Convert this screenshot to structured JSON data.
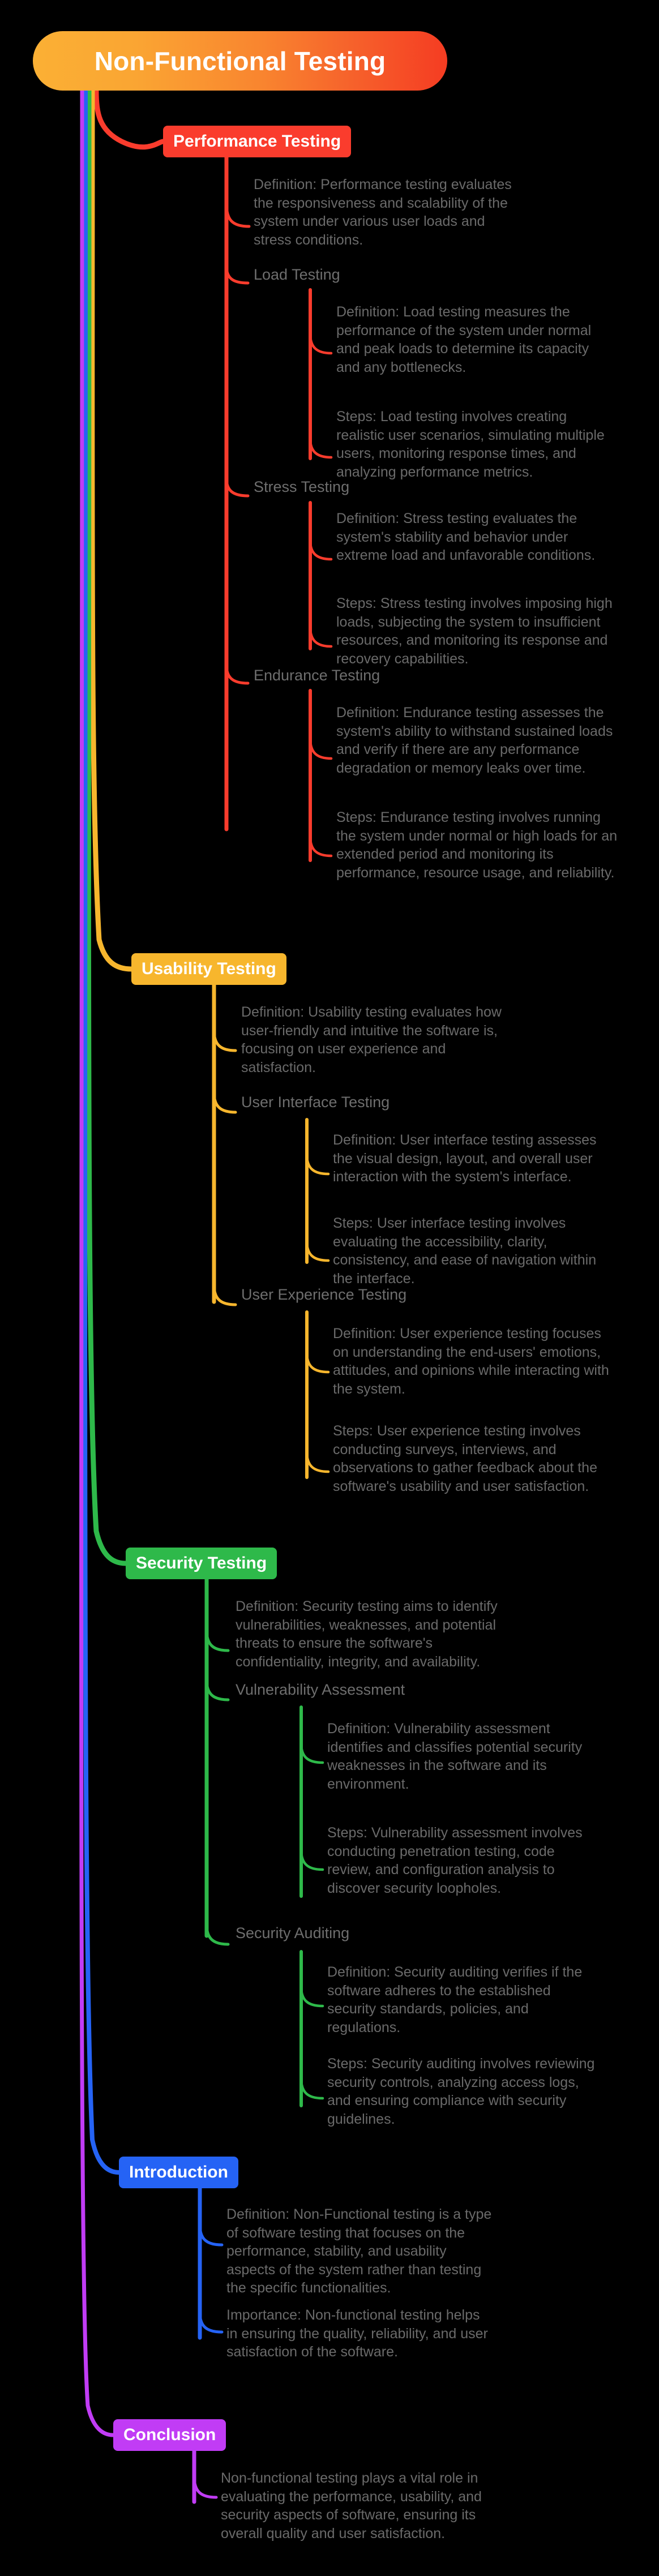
{
  "diagram": {
    "type": "mindmap",
    "background": "#000000",
    "text_color": "#6a6a6a",
    "root": {
      "label": "Non-Functional Testing",
      "gradient_from": "#FBB034",
      "gradient_to": "#F53C22"
    }
  },
  "branches": [
    {
      "id": "performance",
      "label": "Performance Testing",
      "color": "#FA3C2D",
      "overview": "Definition: Performance testing evaluates the responsiveness and scalability of the system under various user loads and stress conditions.",
      "children": [
        {
          "label": "Load Testing",
          "items": [
            "Definition: Load testing measures the performance of the system under normal and peak loads to determine its capacity and any bottlenecks.",
            "Steps: Load testing involves creating realistic user scenarios, simulating multiple users, monitoring response times, and analyzing performance metrics."
          ]
        },
        {
          "label": "Stress Testing",
          "items": [
            "Definition: Stress testing evaluates the system's stability and behavior under extreme load and unfavorable conditions.",
            "Steps: Stress testing involves imposing high loads, subjecting the system to insufficient resources, and monitoring its response and recovery capabilities."
          ]
        },
        {
          "label": "Endurance Testing",
          "items": [
            "Definition: Endurance testing assesses the system's ability to withstand sustained loads and verify if there are any performance degradation or memory leaks over time.",
            "Steps: Endurance testing involves running the system under normal or high loads for an extended period and monitoring its performance, resource usage, and reliability."
          ]
        }
      ]
    },
    {
      "id": "usability",
      "label": "Usability Testing",
      "color": "#F7B62D",
      "overview": "Definition: Usability testing evaluates how user-friendly and intuitive the software is, focusing on user experience and satisfaction.",
      "children": [
        {
          "label": "User Interface Testing",
          "items": [
            "Definition: User interface testing assesses the visual design, layout, and overall user interaction with the system's interface.",
            "Steps: User interface testing involves evaluating the accessibility, clarity, consistency, and ease of navigation within the interface."
          ]
        },
        {
          "label": "User Experience Testing",
          "items": [
            "Definition: User experience testing focuses on understanding the end-users' emotions, attitudes, and opinions while interacting with the system.",
            "Steps: User experience testing involves conducting surveys, interviews, and observations to gather feedback about the software's usability and user satisfaction."
          ]
        }
      ]
    },
    {
      "id": "security",
      "label": "Security Testing",
      "color": "#2EB94A",
      "overview": "Definition: Security testing aims to identify vulnerabilities, weaknesses, and potential threats to ensure the software's confidentiality, integrity, and availability.",
      "children": [
        {
          "label": "Vulnerability Assessment",
          "items": [
            "Definition: Vulnerability assessment identifies and classifies potential security weaknesses in the software and its environment.",
            "Steps: Vulnerability assessment involves conducting penetration testing, code review, and configuration analysis to discover security loopholes."
          ]
        },
        {
          "label": "Security Auditing",
          "items": [
            "Definition: Security auditing verifies if the software adheres to the established security standards, policies, and regulations.",
            "Steps: Security auditing involves reviewing security controls, analyzing access logs, and ensuring compliance with security guidelines."
          ]
        }
      ]
    },
    {
      "id": "introduction",
      "label": "Introduction",
      "color": "#2563F5",
      "overview": "Definition: Non-Functional testing is a type of software testing that focuses on the performance, stability, and usability aspects of the system rather than testing the specific functionalities.",
      "children": [],
      "extra": [
        "Importance: Non-functional testing helps in ensuring the quality, reliability, and user satisfaction of the software."
      ]
    },
    {
      "id": "conclusion",
      "label": "Conclusion",
      "color": "#C13CF5",
      "overview": "Non-functional testing plays a vital role in evaluating the performance, usability, and security aspects of software, ensuring its overall quality and user satisfaction.",
      "children": []
    }
  ]
}
